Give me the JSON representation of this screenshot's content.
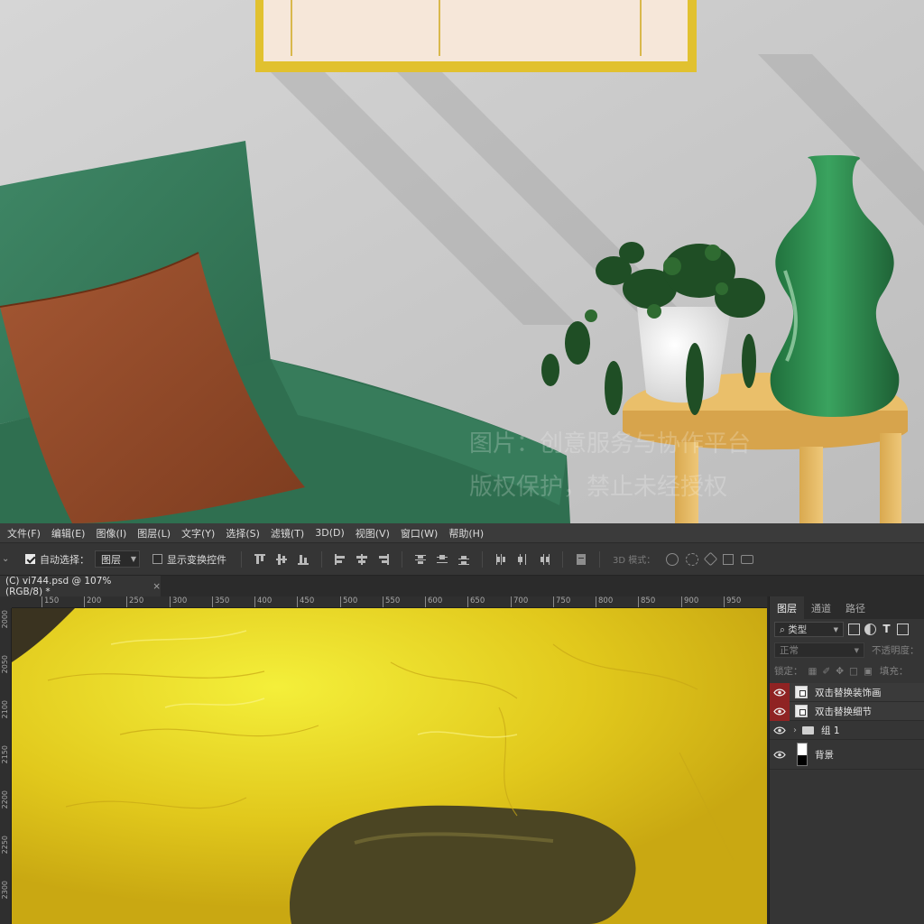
{
  "menu": {
    "items": [
      "文件(F)",
      "编辑(E)",
      "图像(I)",
      "图层(L)",
      "文字(Y)",
      "选择(S)",
      "滤镜(T)",
      "3D(D)",
      "视图(V)",
      "窗口(W)",
      "帮助(H)"
    ]
  },
  "options": {
    "auto_select_label": "自动选择：",
    "auto_select_checked": true,
    "auto_select_target": "图层",
    "show_transform_label": "显示变换控件",
    "show_transform_checked": false,
    "mode_3d_label": "3D 模式："
  },
  "document": {
    "tab_title": "(C) vi744.psd @ 107%(RGB/8) *",
    "close_glyph": "×"
  },
  "rulers": {
    "horizontal": [
      "150",
      "200",
      "250",
      "300",
      "350",
      "400",
      "450",
      "500",
      "550",
      "600",
      "650",
      "700",
      "750",
      "800",
      "850",
      "900",
      "950"
    ],
    "vertical": [
      "2000",
      "2050",
      "2100",
      "2150",
      "2200",
      "2250",
      "2300"
    ]
  },
  "layers_panel": {
    "tabs": [
      "图层",
      "通道",
      "路径"
    ],
    "active_tab": "图层",
    "filter_kind": "类型",
    "blend_mode": "正常",
    "opacity_label": "不透明度：",
    "lock_label": "锁定：",
    "fill_label": "填充：",
    "layers": [
      {
        "name": "双击替换装饰画",
        "type": "smart-object",
        "visible": true,
        "highlight": true
      },
      {
        "name": "双击替换细节",
        "type": "smart-object",
        "visible": true,
        "highlight": true
      },
      {
        "name": "组 1",
        "type": "group",
        "visible": true,
        "highlight": false
      },
      {
        "name": "背景",
        "type": "background",
        "visible": true,
        "highlight": false
      }
    ]
  },
  "scene": {
    "watermark_line1": "图片：创意服务与协作平台",
    "watermark_line2": "版权保护，禁止未经授权"
  },
  "colors": {
    "canvas_yellow": "#e2c91f",
    "armchair_green": "#3f8a66",
    "pillow_brown": "#9a4f2c",
    "table_wood": "#e6bc66",
    "vase_green": "#2e8a4d"
  }
}
